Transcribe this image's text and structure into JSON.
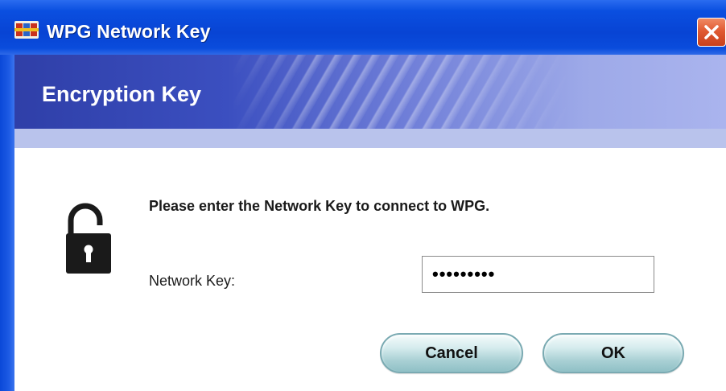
{
  "window": {
    "title": "WPG Network Key",
    "app_icon": "wpg-app-icon",
    "close_icon": "close-icon"
  },
  "banner": {
    "title": "Encryption Key"
  },
  "content": {
    "icon": "unlocked-padlock-icon",
    "prompt": "Please enter the Network Key to connect to WPG.",
    "network_key_label": "Network Key:",
    "network_key_value": "•••••••••"
  },
  "buttons": {
    "cancel_label": "Cancel",
    "ok_label": "OK"
  },
  "colors": {
    "titlebar": "#0844d4",
    "banner": "#3b4fc0",
    "close": "#e05a32",
    "button": "#a9d0d4"
  }
}
